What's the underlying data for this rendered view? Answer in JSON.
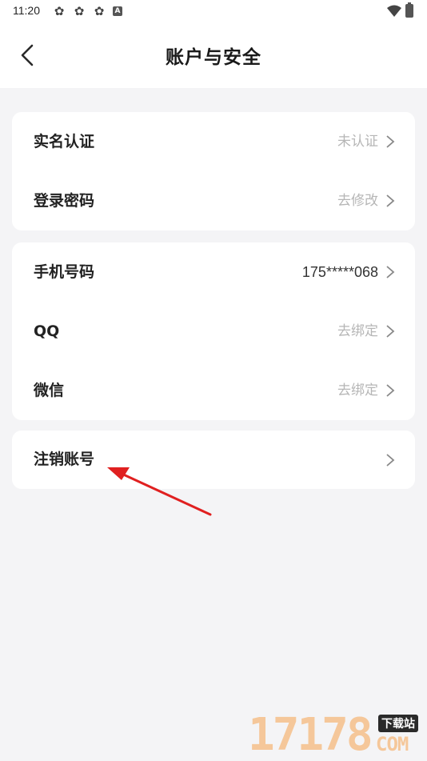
{
  "status_bar": {
    "time": "11:20",
    "notification_icons": [
      "app-icon",
      "app-icon",
      "app-icon"
    ],
    "badge": "A"
  },
  "header": {
    "title": "账户与安全"
  },
  "cards": [
    {
      "rows": [
        {
          "label": "实名认证",
          "value": "未认证"
        },
        {
          "label": "登录密码",
          "value": "去修改"
        }
      ]
    },
    {
      "rows": [
        {
          "label": "手机号码",
          "value": "175*****068"
        },
        {
          "label": "QQ",
          "value": "去绑定"
        },
        {
          "label": "微信",
          "value": "去绑定"
        }
      ]
    },
    {
      "rows": [
        {
          "label": "注销账号",
          "value": ""
        }
      ]
    }
  ],
  "colors": {
    "background": "#f4f4f6",
    "annotation_arrow": "#e02020",
    "value_grey": "#b6b6b6"
  },
  "watermark": {
    "number": "17178",
    "tag": "下载站",
    "domain": "COM"
  }
}
